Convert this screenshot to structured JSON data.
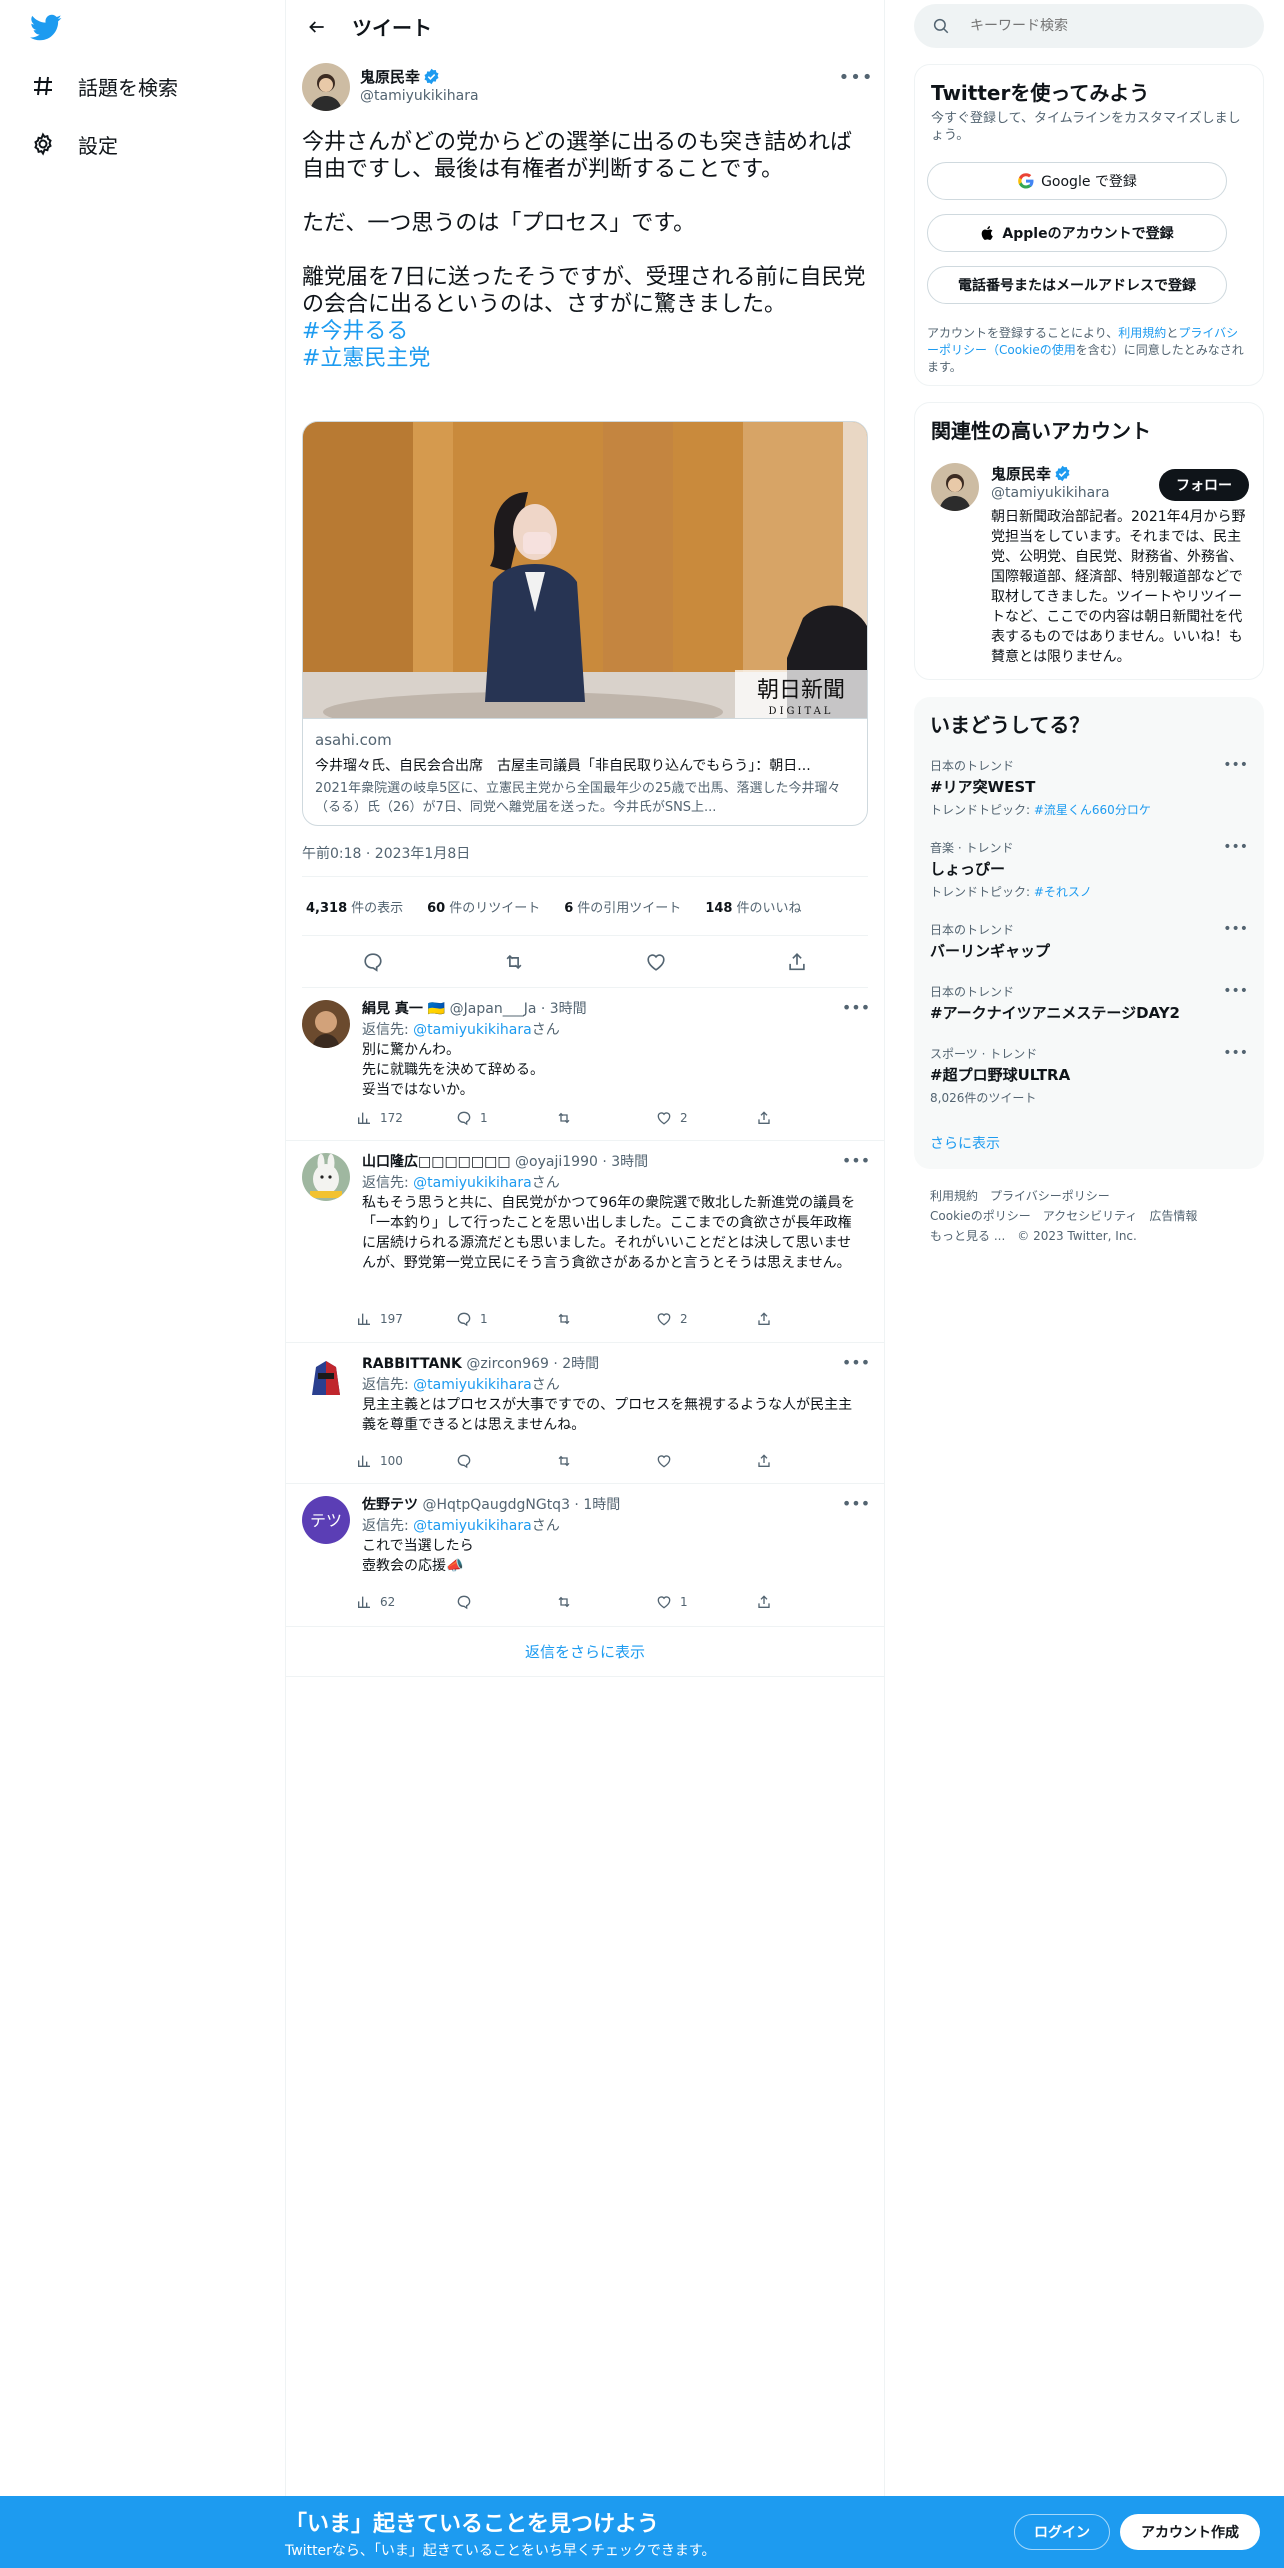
{
  "colors": {
    "accent": "#1d9bf0",
    "text": "#0f1419",
    "muted": "#536471",
    "border": "#eff3f4"
  },
  "nav": {
    "logo_icon": "twitter-bird-icon",
    "items": [
      {
        "label": "話題を検索",
        "icon": "hashtag-icon"
      },
      {
        "label": "設定",
        "icon": "gear-icon"
      }
    ]
  },
  "header": {
    "title": "ツイート"
  },
  "tweet": {
    "author_name": "鬼原民幸",
    "author_handle": "@tamiyukikihara",
    "text": "今井さんがどの党からどの選挙に出るのも突き詰めれば自由ですし、最後は有権者が判断することです。\n\nただ、一つ思うのは「プロセス」です。\n\n離党届を7日に送ったそうですが、受理される前に自民党の会合に出るというのは、さすがに驚きました。",
    "hashtags": [
      "#今井るる",
      "#立憲民主党"
    ],
    "card": {
      "domain": "asahi.com",
      "title": "今井瑠々氏、自民会合出席　古屋圭司議員「非自民取り込んでもらう」：朝日...",
      "description": "2021年衆院選の岐阜5区に、立憲民主党から全国最年少の25歳で出馬、落選した今井瑠々（るる）氏（26）が7日、同党へ離党届を送った。今井氏がSNS上...",
      "watermark_line1": "朝日新聞",
      "watermark_line2": "DIGITAL"
    },
    "timestamp": "午前0:18 · 2023年1月8日",
    "stats": [
      {
        "value": "4,318",
        "label": "件の表示"
      },
      {
        "value": "60",
        "label": "件のリツイート"
      },
      {
        "value": "6",
        "label": "件の引用ツイート"
      },
      {
        "value": "148",
        "label": "件のいいね"
      }
    ]
  },
  "replies": [
    {
      "name": "絹見 真一 🇺🇦",
      "handle": "@Japan___Ja · 3時間",
      "reply_prefix": "返信先: ",
      "reply_to": "@tamiyukikihara",
      "reply_suffix": "さん",
      "text": "別に驚かんわ。\n先に就職先を決めて辞める。\n妥当ではないか。",
      "views": "172",
      "replies": "1",
      "retweets": "",
      "likes": "2",
      "avatar_color": "#6b4a2e"
    },
    {
      "name": "山口隆広□□□□□□□",
      "handle": "@oyaji1990 · 3時間",
      "reply_prefix": "返信先: ",
      "reply_to": "@tamiyukikihara",
      "reply_suffix": "さん",
      "text": "私もそう思うと共に、自民党がかつて96年の衆院選で敗北した新進党の議員を「一本釣り」して行ったことを思い出しました。ここまでの貪欲さが長年政権に居続けられる源流だとも思いました。それがいいことだとは決して思いませんが、野党第一党立民にそう言う貪欲さがあるかと言うとそうは思えません。",
      "views": "197",
      "replies": "1",
      "retweets": "",
      "likes": "2",
      "avatar_color": "#9fb7a0"
    },
    {
      "name": "RABBITTANK",
      "handle": "@zircon969 · 2時間",
      "reply_prefix": "返信先: ",
      "reply_to": "@tamiyukikihara",
      "reply_suffix": "さん",
      "text": "見主主義とはプロセスが大事ですでの、プロセスを無視するような人が民主主義を尊重できるとは思えませんね。",
      "views": "100",
      "replies": "",
      "retweets": "",
      "likes": "",
      "avatar_color": "#2a3f8f"
    },
    {
      "name": "佐野テツ",
      "handle": "@HqtpQaugdgNGtq3 · 1時間",
      "reply_prefix": "返信先: ",
      "reply_to": "@tamiyukikihara",
      "reply_suffix": "さん",
      "text": "これで当選したら\n壺教会の応援📣",
      "views": "62",
      "replies": "",
      "retweets": "",
      "likes": "1",
      "avatar_text": "テツ",
      "avatar_color": "#5b3eb5"
    }
  ],
  "show_more_replies": "返信をさらに表示",
  "right": {
    "search_placeholder": "キーワード検索",
    "signup": {
      "title": "Twitterを使ってみよう",
      "desc": "今すぐ登録して、タイムラインをカスタマイズしましょう。",
      "google_btn": "Google で登録",
      "apple_btn": "Appleのアカウントで登録",
      "phone_btn": "電話番号またはメールアドレスで登録",
      "terms_1": "アカウントを登録することにより、",
      "terms_link1": "利用規約",
      "terms_2": "と",
      "terms_link2": "プライバシーポリシー（Cookieの使用",
      "terms_3": "を含む）に同意したとみなされます。"
    },
    "related": {
      "title": "関連性の高いアカウント",
      "name": "鬼原民幸",
      "handle": "@tamiyukikihara",
      "follow": "フォロー",
      "bio": "朝日新聞政治部記者。2021年4月から野党担当をしています。それまでは、民主党、公明党、自民党、財務省、外務省、国際報道部、経済部、特別報道部などで取材してきました。ツイートやリツイートなど、ここでの内容は朝日新聞社を代表するものではありません。いいね！も賛意とは限りません。"
    },
    "trends": {
      "title": "いまどうしてる？",
      "items": [
        {
          "category": "日本のトレンド",
          "name": "#リア突WEST",
          "sub_prefix": "トレンドトピック: ",
          "sub_link": "#流星くん660分ロケ",
          "count": ""
        },
        {
          "category": "音楽 · トレンド",
          "name": "しょっぴー",
          "sub_prefix": "トレンドトピック: ",
          "sub_link": "#それスノ",
          "count": ""
        },
        {
          "category": "日本のトレンド",
          "name": "バーリンギャップ",
          "sub_prefix": "",
          "sub_link": "",
          "count": ""
        },
        {
          "category": "日本のトレンド",
          "name": "#アークナイツアニメステージDAY2",
          "sub_prefix": "",
          "sub_link": "",
          "count": ""
        },
        {
          "category": "スポーツ · トレンド",
          "name": "#超プロ野球ULTRA",
          "sub_prefix": "",
          "sub_link": "",
          "count": "8,026件のツイート"
        }
      ],
      "show_more": "さらに表示"
    },
    "footer": {
      "links": [
        "利用規約",
        "プライバシーポリシー",
        "Cookieのポリシー",
        "アクセシビリティ",
        "広告情報",
        "もっと見る ..."
      ],
      "copyright": "© 2023 Twitter, Inc."
    }
  },
  "bottom_bar": {
    "title": "「いま」起きていることを見つけよう",
    "subtitle": "Twitterなら、「いま」起きていることをいち早くチェックできます。",
    "login": "ログイン",
    "signup": "アカウント作成"
  }
}
